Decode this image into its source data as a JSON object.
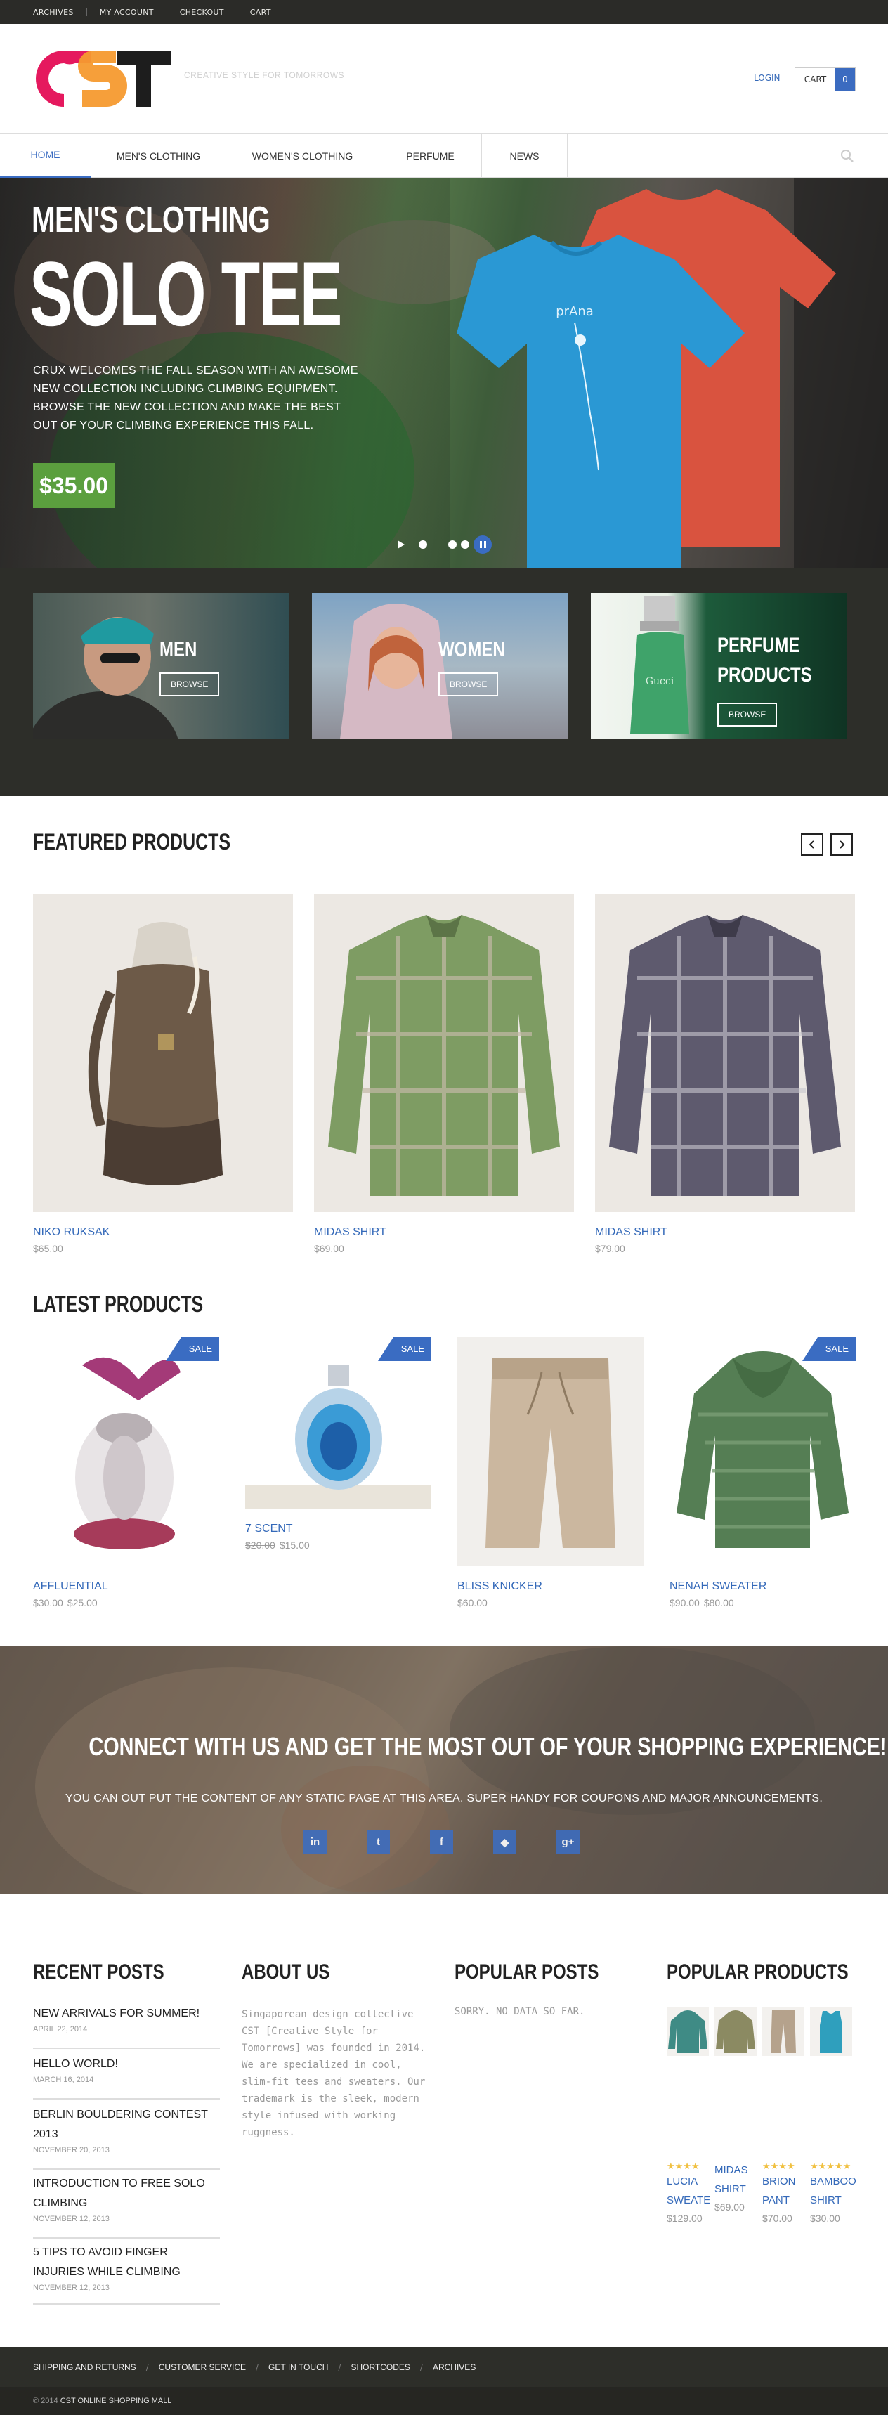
{
  "topbar": {
    "links": [
      "ARCHIVES",
      "MY ACCOUNT",
      "CHECKOUT",
      "CART"
    ]
  },
  "header": {
    "logo": "CST",
    "tagline": "CREATIVE STYLE FOR TOMORROWS",
    "login": "LOGIN",
    "cart_label": "CART",
    "cart_count": "0"
  },
  "nav": {
    "items": [
      "HOME",
      "MEN'S CLOTHING",
      "WOMEN'S CLOTHING",
      "PERFUME",
      "NEWS"
    ],
    "active": "HOME"
  },
  "hero": {
    "category": "MEN'S CLOTHING",
    "title": "SOLO TEE",
    "description": "CRUX WELCOMES THE FALL SEASON WITH AN AWESOME NEW COLLECTION INCLUDING CLIMBING EQUIPMENT. BROWSE THE NEW COLLECTION AND MAKE THE BEST OUT OF YOUR CLIMBING EXPERIENCE THIS FALL.",
    "price": "$35.00",
    "shirt_brand": "prAna"
  },
  "categories": [
    {
      "label": "MEN",
      "button": "BROWSE"
    },
    {
      "label": "WOMEN",
      "button": "BROWSE"
    },
    {
      "label": "PERFUME PRODUCTS",
      "line1": "PERFUME",
      "line2": "PRODUCTS",
      "button": "BROWSE",
      "bottle_text": "Gucci"
    }
  ],
  "featured": {
    "title": "FEATURED PRODUCTS",
    "products": [
      {
        "name": "NIKO RUKSAK",
        "price": "$65.00"
      },
      {
        "name": "MIDAS SHIRT",
        "price": "$69.00"
      },
      {
        "name": "MIDAS SHIRT",
        "price": "$79.00"
      }
    ]
  },
  "latest": {
    "title": "LATEST PRODUCTS",
    "sale_label": "SALE",
    "products": [
      {
        "name": "AFFLUENTIAL",
        "old_price": "$30.00",
        "price": "$25.00",
        "sale": true
      },
      {
        "name": "7 SCENT",
        "old_price": "$20.00",
        "price": "$15.00",
        "sale": true
      },
      {
        "name": "BLISS KNICKER",
        "old_price": "",
        "price": "$60.00",
        "sale": false
      },
      {
        "name": "NENAH SWEATER",
        "old_price": "$90.00",
        "price": "$80.00",
        "sale": true
      }
    ]
  },
  "connect": {
    "title": "CONNECT WITH US AND GET THE MOST OUT OF YOUR SHOPPING EXPERIENCE!",
    "text": "YOU CAN OUT PUT THE CONTENT OF ANY STATIC PAGE AT THIS AREA. SUPER HANDY FOR COUPONS AND MAJOR ANNOUNCEMENTS.",
    "socials": [
      "linkedin-icon",
      "twitter-icon",
      "facebook-icon",
      "dribbble-icon",
      "google-plus-icon"
    ]
  },
  "widgets": {
    "recent_title": "RECENT POSTS",
    "posts": [
      {
        "title": "NEW ARRIVALS FOR SUMMER!",
        "date": "APRIL 22, 2014"
      },
      {
        "title": "HELLO WORLD!",
        "date": "MARCH 16, 2014"
      },
      {
        "title": "BERLIN BOULDERING CONTEST 2013",
        "date": "NOVEMBER 20, 2013"
      },
      {
        "title": "INTRODUCTION TO FREE SOLO CLIMBING",
        "date": "NOVEMBER 12, 2013"
      },
      {
        "title": "5 TIPS TO AVOID FINGER INJURIES WHILE CLIMBING",
        "date": "NOVEMBER 12, 2013"
      }
    ],
    "about_title": "ABOUT US",
    "about_text": "Singaporean design collective CST [Creative Style for Tomorrows] was founded in 2014. We are specialized in cool, slim-fit tees and sweaters. Our trademark is the sleek, modern style infused with working ruggness.",
    "popular_posts_title": "POPULAR POSTS",
    "popular_posts_empty": "SORRY. NO DATA SO FAR.",
    "popular_products_title": "POPULAR PRODUCTS",
    "popular_products": [
      {
        "name": "LUCIA SWEATE",
        "price": "$129.00",
        "stars": "★★★★"
      },
      {
        "name": "MIDAS SHIRT",
        "price": "$69.00",
        "stars": ""
      },
      {
        "name": "BRION PANT",
        "price": "$70.00",
        "stars": "★★★★"
      },
      {
        "name": "BAMBOO SHIRT",
        "price": "$30.00",
        "stars": "★★★★★"
      }
    ]
  },
  "footer": {
    "links": [
      "SHIPPING AND RETURNS",
      "CUSTOMER SERVICE",
      "GET IN TOUCH",
      "SHORTCODES",
      "ARCHIVES"
    ],
    "copyright_prefix": "© 2014",
    "copyright_name": "CST ONLINE SHOPPING MALL"
  },
  "colors": {
    "accent": "#3a6cc2",
    "dark": "#2d2e29",
    "price_green": "#5b9f3e"
  }
}
